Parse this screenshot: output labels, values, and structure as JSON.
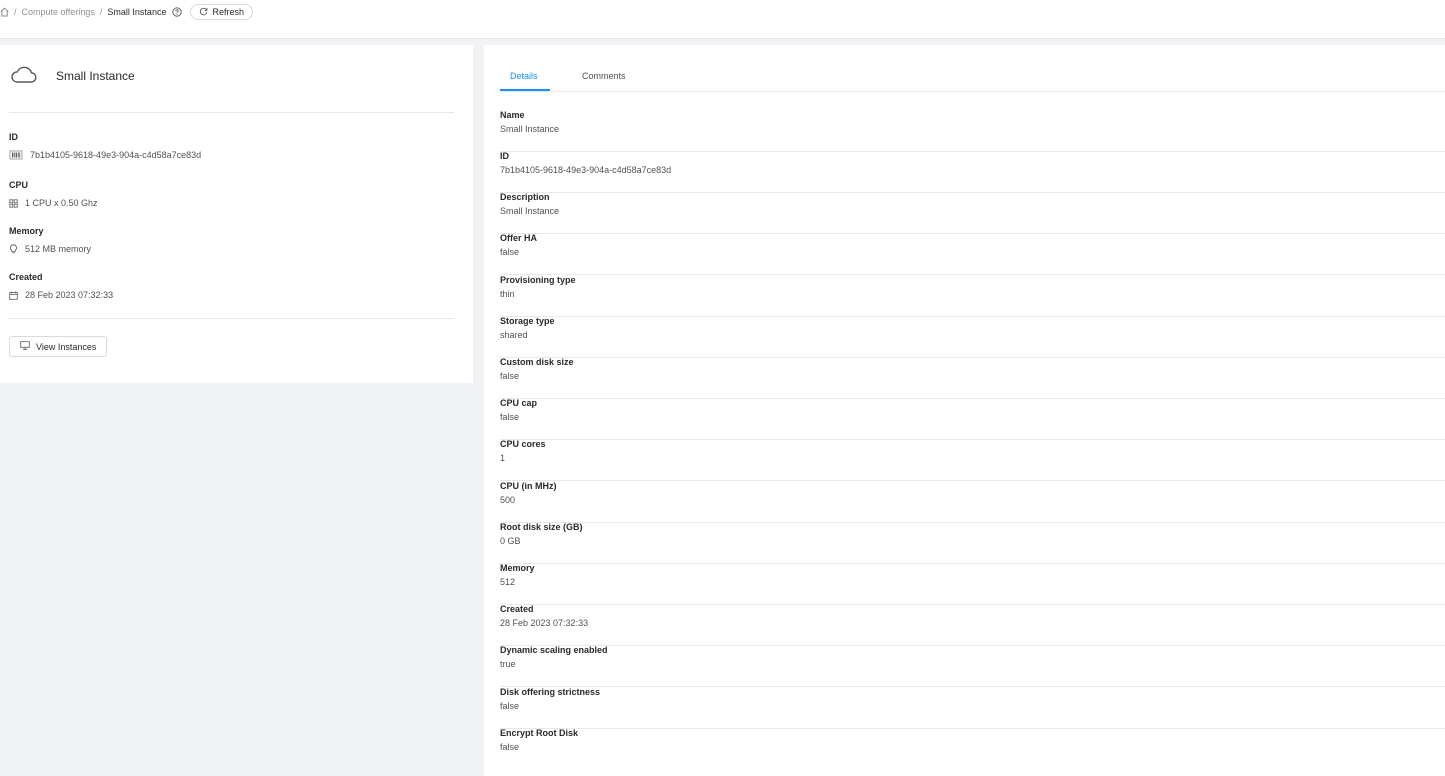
{
  "breadcrumb": {
    "home_icon": "home-icon",
    "separator": "/",
    "parent": "Compute offerings",
    "current": "Small Instance",
    "help_icon": "question-circle-icon",
    "refresh_label": "Refresh",
    "refresh_icon": "reload-icon"
  },
  "resource": {
    "icon": "cloud-icon",
    "name": "Small Instance",
    "id_label": "ID",
    "id_icon": "barcode-icon",
    "id_value": "7b1b4105-9618-49e3-904a-c4d58a7ce83d",
    "cpu_label": "CPU",
    "cpu_icon": "appstore-icon",
    "cpu_value": "1 CPU x 0.50 Ghz",
    "memory_label": "Memory",
    "memory_icon": "bulb-icon",
    "memory_value": "512 MB memory",
    "created_label": "Created",
    "created_icon": "calendar-icon",
    "created_value": "28 Feb 2023 07:32:33",
    "view_instances_label": "View Instances",
    "view_instances_icon": "desktop-icon"
  },
  "tabs": [
    {
      "label": "Details",
      "active": true
    },
    {
      "label": "Comments",
      "active": false
    }
  ],
  "details": [
    {
      "label": "Name",
      "value": "Small Instance"
    },
    {
      "label": "ID",
      "value": "7b1b4105-9618-49e3-904a-c4d58a7ce83d"
    },
    {
      "label": "Description",
      "value": "Small Instance"
    },
    {
      "label": "Offer HA",
      "value": "false"
    },
    {
      "label": "Provisioning type",
      "value": "thin"
    },
    {
      "label": "Storage type",
      "value": "shared"
    },
    {
      "label": "Custom disk size",
      "value": "false"
    },
    {
      "label": "CPU cap",
      "value": "false"
    },
    {
      "label": "CPU cores",
      "value": "1"
    },
    {
      "label": "CPU (in MHz)",
      "value": "500"
    },
    {
      "label": "Root disk size (GB)",
      "value": "0 GB"
    },
    {
      "label": "Memory",
      "value": "512"
    },
    {
      "label": "Created",
      "value": "28 Feb 2023 07:32:33"
    },
    {
      "label": "Dynamic scaling enabled",
      "value": "true"
    },
    {
      "label": "Disk offering strictness",
      "value": "false"
    },
    {
      "label": "Encrypt Root Disk",
      "value": "false"
    }
  ],
  "colors": {
    "accent": "#1890ff",
    "background": "#f0f2f5"
  }
}
